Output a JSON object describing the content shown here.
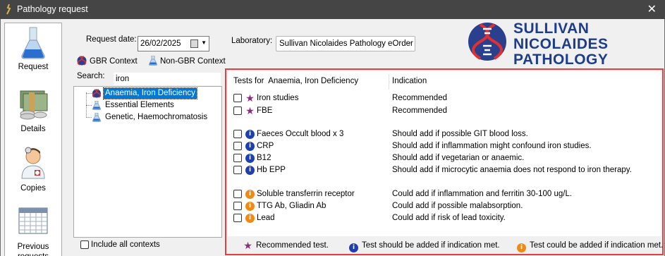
{
  "window": {
    "title": "Pathology request",
    "close_glyph": "✕"
  },
  "nav": {
    "items": [
      {
        "label": "Request",
        "icon": "flask-icon"
      },
      {
        "label": "Details",
        "icon": "money-icon"
      },
      {
        "label": "Copies",
        "icon": "doctor-icon"
      },
      {
        "label_line1": "Previous",
        "label_line2": "requests",
        "icon": "calendar-icon"
      }
    ]
  },
  "form": {
    "request_date_label": "Request date:",
    "request_date_value": "26/02/2025",
    "laboratory_label": "Laboratory:",
    "laboratory_value": "Sullivan Nicolaides Pathology eOrder",
    "gbr_context_label": "GBR Context",
    "non_gbr_context_label": "Non-GBR Context",
    "search_label": "Search:",
    "search_value": "iron",
    "include_all_contexts_label": "Include all contexts"
  },
  "logo": {
    "line1": "SULLIVAN",
    "line2": "NICOLAIDES",
    "line3": "PATHOLOGY",
    "color": "#1d3c8c"
  },
  "tree": {
    "items": [
      {
        "label": "Anaemia, Iron Deficiency",
        "selected": true,
        "icon": "dna-icon"
      },
      {
        "label": "Essential Elements",
        "selected": false,
        "icon": "flask-icon"
      },
      {
        "label": "Genetic, Haemochromatosis",
        "selected": false,
        "icon": "flask-icon"
      }
    ]
  },
  "tests": {
    "header_prefix": "Tests for",
    "header_context": "Anaemia, Iron Deficiency",
    "indication_header": "Indication",
    "rows": [
      {
        "name": "Iron studies",
        "indication": "Recommended",
        "level": "recommended"
      },
      {
        "name": "FBE",
        "indication": "Recommended",
        "level": "recommended"
      },
      {
        "name": "Faeces Occult blood x 3",
        "indication": "Should add if possible GIT blood loss.",
        "level": "should"
      },
      {
        "name": "CRP",
        "indication": "Should add if inflammation might confound iron studies.",
        "level": "should"
      },
      {
        "name": "B12",
        "indication": "Should add if vegetarian or anaemic.",
        "level": "should"
      },
      {
        "name": "Hb EPP",
        "indication": "Should add if microcytic anaemia does not respond to iron therapy.",
        "level": "should"
      },
      {
        "name": "Soluble transferrin receptor",
        "indication": "Could add if inflammation and ferritin 30-100 ug/L.",
        "level": "could"
      },
      {
        "name": "TTG Ab, Gliadin Ab",
        "indication": "Could add if possible malabsorption.",
        "level": "could"
      },
      {
        "name": "Lead",
        "indication": "Could add if risk of lead toxicity.",
        "level": "could"
      }
    ]
  },
  "legend": {
    "recommended": "Recommended test.",
    "should": "Test should be added if indication met.",
    "could": "Test could be added if indication met."
  },
  "colors": {
    "recommended_star": "#8e2a7a",
    "should_badge": "#1f3fb0",
    "could_badge": "#f08a12",
    "highlight_border": "#e04040",
    "selection": "#0078d7"
  }
}
